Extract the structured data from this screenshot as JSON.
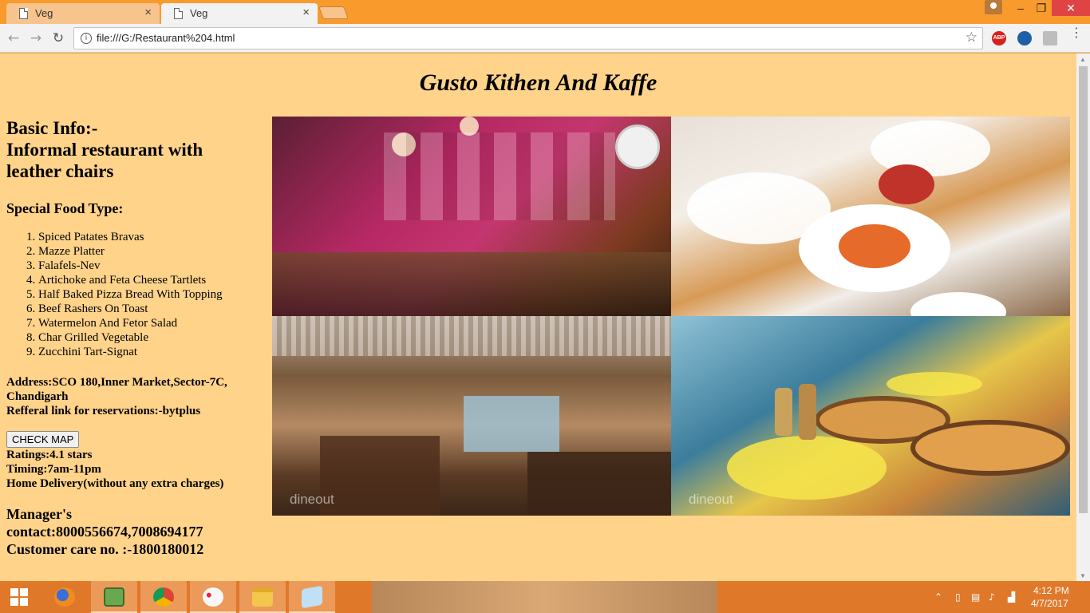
{
  "browser": {
    "tabs": [
      {
        "label": "Veg",
        "active": false
      },
      {
        "label": "Veg",
        "active": true
      }
    ],
    "tab_close_glyph": "×",
    "url": "file:///G:/Restaurant%204.html",
    "extensions": [
      "ABP",
      "IE",
      "PDF"
    ],
    "window_buttons": {
      "minimize": "–",
      "maximize": "❐",
      "close": "✕"
    }
  },
  "page": {
    "title": "Gusto Kithen And Kaffe",
    "basic_info_heading": "Basic Info:-",
    "basic_info_text": "Informal restaurant with leather chairs",
    "special_food_heading": "Special Food Type:",
    "food_items": [
      "Spiced Patates Bravas",
      "Mazze Platter",
      "Falafels-Nev",
      "Artichoke and Feta Cheese Tartlets",
      "Half Baked Pizza Bread With Topping",
      "Beef Rashers On Toast",
      "Watermelon And Fetor Salad",
      "Char Grilled Vegetable",
      "Zucchini Tart-Signat"
    ],
    "address": "Address:SCO 180,Inner Market,Sector-7C, Chandigarh",
    "referral": "Refferal link for reservations:-bytplus",
    "check_map_label": "CHECK MAP",
    "ratings": "Ratings:4.1 stars",
    "timing": "Timing:7am-11pm",
    "home_delivery": "Home Delivery(without any extra charges)",
    "manager_contact": "Manager's contact:8000556674,7008694177",
    "customer_care": "Customer care no. :-1800180012",
    "watermark": "dineout",
    "photos": [
      "interior-pink-wall",
      "plated-food",
      "buffet-hall",
      "pizza-table"
    ]
  },
  "taskbar": {
    "apps": [
      "firefox",
      "system-monitor",
      "chrome",
      "paint",
      "file-explorer",
      "notepad"
    ],
    "time": "4:12 PM",
    "date": "4/7/2017"
  },
  "colors": {
    "page_background": "#ffd38a",
    "chrome_accent": "#f99b2c",
    "taskbar": "#e0782a",
    "close_button": "#e04343"
  }
}
